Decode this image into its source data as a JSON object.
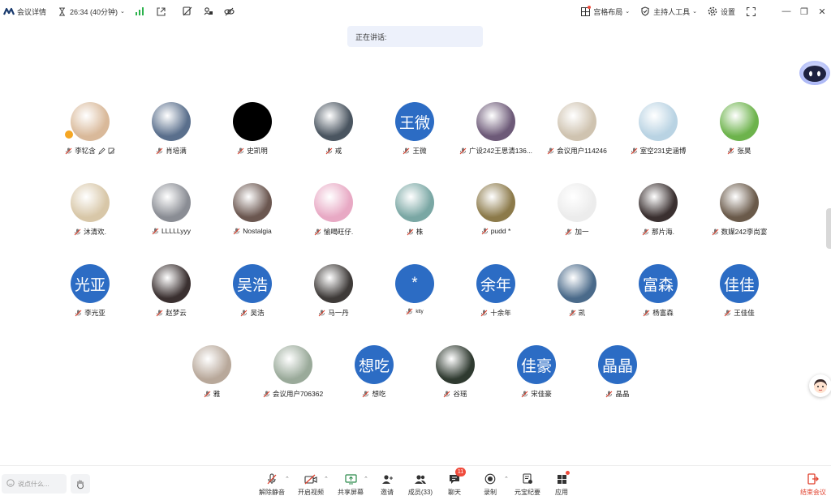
{
  "topbar": {
    "meeting_details": "会议详情",
    "timer": "26:34 (40分钟)",
    "layout": "宫格布局",
    "host_tools": "主持人工具",
    "settings": "设置"
  },
  "speaking": {
    "label": "正在讲话:"
  },
  "participants": [
    [
      {
        "name": "李钇含",
        "type": "img",
        "color": "#d9b99a",
        "host": true,
        "extra": true
      },
      {
        "name": "肖培满",
        "type": "img",
        "color": "#5a6f8c"
      },
      {
        "name": "史凯明",
        "type": "img",
        "color": "#000000"
      },
      {
        "name": "戒",
        "type": "img",
        "color": "#4a5560"
      },
      {
        "name": "王微",
        "type": "text",
        "avatar_text": "王微"
      },
      {
        "name": "广设242王思清136...",
        "type": "img",
        "color": "#6d5a78"
      },
      {
        "name": "会议用户114246",
        "type": "img",
        "color": "#cfc3b0"
      },
      {
        "name": "室空231史涵博",
        "type": "img",
        "color": "#b9d3e3"
      },
      {
        "name": "张昊",
        "type": "img",
        "color": "#6db34c"
      }
    ],
    [
      {
        "name": "沐清欢.",
        "type": "img",
        "color": "#d8c7a8"
      },
      {
        "name": "LLLLLyyy",
        "type": "img",
        "color": "#8a8d94"
      },
      {
        "name": "Nostalgia",
        "type": "img",
        "color": "#6b5750"
      },
      {
        "name": "愉喝旺仔.",
        "type": "img",
        "color": "#e8a9c4"
      },
      {
        "name": "株",
        "type": "img",
        "color": "#7aa7a4"
      },
      {
        "name": "pudd *",
        "type": "img",
        "color": "#8c7a4a"
      },
      {
        "name": "加一",
        "type": "img",
        "color": "#ececec"
      },
      {
        "name": "那片海.",
        "type": "img",
        "color": "#3a3030"
      },
      {
        "name": "数媒242李尚宴",
        "type": "img",
        "color": "#6a5a4a"
      }
    ],
    [
      {
        "name": "李光亚",
        "type": "text",
        "avatar_text": "光亚"
      },
      {
        "name": "赵梦云",
        "type": "img",
        "color": "#3a3030"
      },
      {
        "name": "吴浩",
        "type": "text",
        "avatar_text": "吴浩"
      },
      {
        "name": "马一丹",
        "type": "img",
        "color": "#3e3a38"
      },
      {
        "name": "ktty",
        "type": "text",
        "avatar_text": "*"
      },
      {
        "name": "十余年",
        "type": "text",
        "avatar_text": "余年"
      },
      {
        "name": "凯",
        "type": "img",
        "color": "#4a6a8a"
      },
      {
        "name": "杨富森",
        "type": "text",
        "avatar_text": "富森"
      },
      {
        "name": "王佳佳",
        "type": "text",
        "avatar_text": "佳佳"
      }
    ],
    [
      {
        "name": "雅",
        "type": "img",
        "color": "#b8a89a"
      },
      {
        "name": "会议用户706362",
        "type": "img",
        "color": "#9aaa9a"
      },
      {
        "name": "想吃",
        "type": "text",
        "avatar_text": "想吃"
      },
      {
        "name": "谷瑶",
        "type": "img",
        "color": "#2f3a30"
      },
      {
        "name": "宋佳豪",
        "type": "text",
        "avatar_text": "佳豪"
      },
      {
        "name": "晶晶",
        "type": "text",
        "avatar_text": "晶晶"
      }
    ]
  ],
  "bottombar": {
    "chat_placeholder": "说点什么...",
    "unmute": "解除静音",
    "start_video": "开启视频",
    "share_screen": "共享屏幕",
    "invite": "邀请",
    "members": "成员(33)",
    "chat": "聊天",
    "chat_badge": "11",
    "record": "录制",
    "ai_minutes": "元宝纪要",
    "apps": "应用",
    "end_meeting": "结束会议"
  },
  "colors": {
    "avatar_blue": "#2c6cc4",
    "accent": "#2c6cc4",
    "danger": "#e0402d"
  }
}
